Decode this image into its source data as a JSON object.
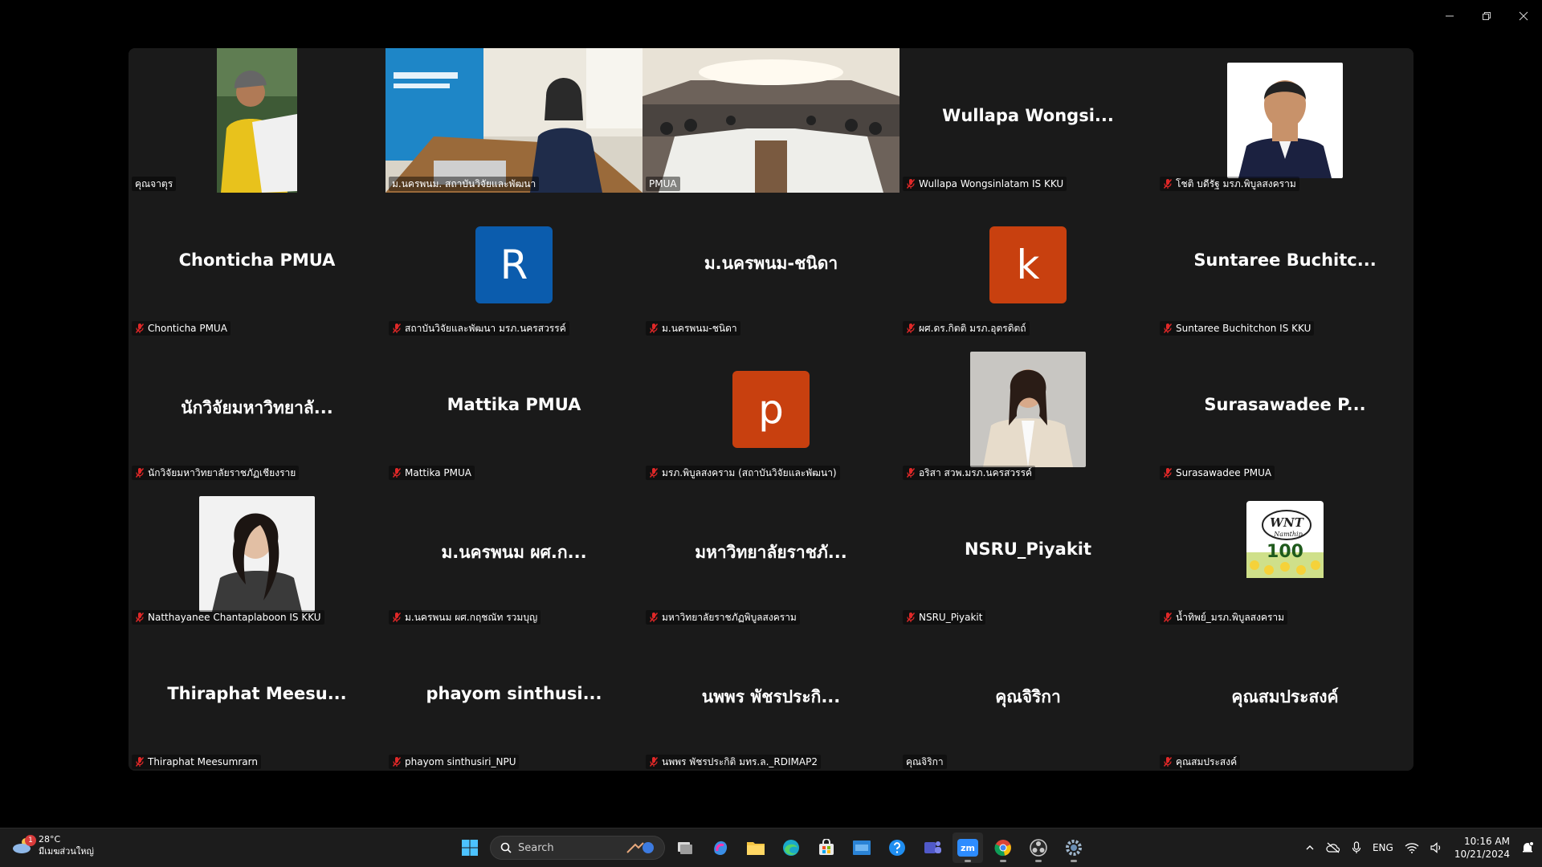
{
  "window": {
    "controls": [
      {
        "name": "minimize-icon"
      },
      {
        "name": "restore-icon"
      },
      {
        "name": "close-icon"
      }
    ]
  },
  "gallery": {
    "tiles": [
      {
        "label": "คุณจาตุร",
        "type": "video-narrow",
        "muted": false,
        "scene": "person-yellow"
      },
      {
        "label": "ม.นครพนม. สถาบันวิจัยและพัฒนา",
        "type": "video",
        "muted": false,
        "scene": "office-banner"
      },
      {
        "label": "PMUA",
        "type": "video",
        "muted": false,
        "scene": "meeting-room",
        "active": true
      },
      {
        "display": "Wullapa  Wongsi...",
        "label": "Wullapa Wongsinlatam IS KKU",
        "type": "name",
        "muted": true
      },
      {
        "label": "โชติ บดีรัฐ มรภ.พิบูลสงคราม",
        "type": "photo",
        "muted": true,
        "scene": "man-suit"
      },
      {
        "display": "Chonticha PMUA",
        "label": "Chonticha PMUA",
        "type": "name",
        "muted": true
      },
      {
        "initial": "R",
        "color": "#0b5cad",
        "label": "สถาบันวิจัยและพัฒนา มรภ.นครสวรรค์",
        "type": "avatar",
        "muted": true
      },
      {
        "display": "ม.นครพนม-ชนิดา",
        "label": "ม.นครพนม-ชนิดา",
        "type": "name",
        "muted": true
      },
      {
        "initial": "k",
        "color": "#c8400f",
        "label": "ผศ.ดร.กิตติ  มรภ.อุตรดิตถ์",
        "type": "avatar",
        "muted": true
      },
      {
        "display": "Suntaree  Buchitc...",
        "label": "Suntaree Buchitchon IS KKU",
        "type": "name",
        "muted": true
      },
      {
        "display": "นักวิจัยมหาวิทยาลั...",
        "label": "นักวิจัยมหาวิทยาลัยราชภัฏเชียงราย",
        "type": "name",
        "muted": true
      },
      {
        "display": "Mattika PMUA",
        "label": "Mattika PMUA",
        "type": "name",
        "muted": true
      },
      {
        "initial": "p",
        "color": "#c8400f",
        "label": "มรภ.พิบูลสงคราม (สถาบันวิจัยและพัฒนา)",
        "type": "avatar",
        "muted": true
      },
      {
        "label": "อริสา สวพ.มรภ.นครสวรรค์",
        "type": "photo",
        "muted": true,
        "scene": "woman-coat"
      },
      {
        "display": "Surasawadee  P...",
        "label": "Surasawadee PMUA",
        "type": "name",
        "muted": true
      },
      {
        "label": "Natthayanee Chantaplaboon IS KKU",
        "type": "photo",
        "muted": true,
        "scene": "woman-dark"
      },
      {
        "display": "ม.นครพนม ผศ.ก...",
        "label": "ม.นครพนม ผศ.กฤชณัท รวมบุญ",
        "type": "name",
        "muted": true
      },
      {
        "display": "มหาวิทยาลัยราชภั...",
        "label": "มหาวิทยาลัยราชภัฏพิบูลสงคราม",
        "type": "name",
        "muted": true
      },
      {
        "display": "NSRU_Piyakit",
        "label": "NSRU_Piyakit",
        "type": "name",
        "muted": true
      },
      {
        "label": "น้ำทิพย์_มรภ.พิบูลสงคราม",
        "type": "logo",
        "muted": true,
        "logo_text": "WNT",
        "logo_sub": "Namthip",
        "logo_num": "100"
      },
      {
        "display": "Thiraphat  Meesu...",
        "label": "Thiraphat Meesumrarn",
        "type": "name",
        "muted": true
      },
      {
        "display": "phayom  sinthusi...",
        "label": "phayom sinthusiri_NPU",
        "type": "name",
        "muted": true
      },
      {
        "display": "นพพร  พัชรประกิ...",
        "label": "นพพร พัชรประกิติ มทร.ล._RDIMAP2",
        "type": "name",
        "muted": true
      },
      {
        "display": "คุณจิริกา",
        "label": "คุณจิริกา",
        "type": "name",
        "muted": false
      },
      {
        "display": "คุณสมประสงค์",
        "label": "คุณสมประสงค์",
        "type": "name",
        "muted": true
      }
    ]
  },
  "taskbar": {
    "weather": {
      "temp": "28°C",
      "desc": "มีเมฆส่วนใหญ่",
      "badge": "1"
    },
    "search_label": "Search",
    "apps": [
      {
        "name": "windows-start-icon",
        "running": false
      },
      {
        "name": "search"
      },
      {
        "name": "task-view-icon",
        "running": false
      },
      {
        "name": "copilot-icon",
        "running": false
      },
      {
        "name": "file-explorer-icon",
        "running": false
      },
      {
        "name": "edge-icon",
        "running": false
      },
      {
        "name": "microsoft-store-icon",
        "running": false
      },
      {
        "name": "mobile-link-icon",
        "running": false
      },
      {
        "name": "help-icon",
        "running": false
      },
      {
        "name": "teams-icon",
        "running": false
      },
      {
        "name": "zoom-icon",
        "running": true,
        "text": "zm"
      },
      {
        "name": "chrome-icon",
        "running": true
      },
      {
        "name": "obs-icon",
        "running": true
      },
      {
        "name": "settings-icon",
        "running": true
      }
    ],
    "tray": {
      "language": "ENG",
      "time": "10:16 AM",
      "date": "10/21/2024"
    },
    "colors": {
      "zoom": "#2d8cff",
      "active_border": "#2fd07a"
    }
  }
}
